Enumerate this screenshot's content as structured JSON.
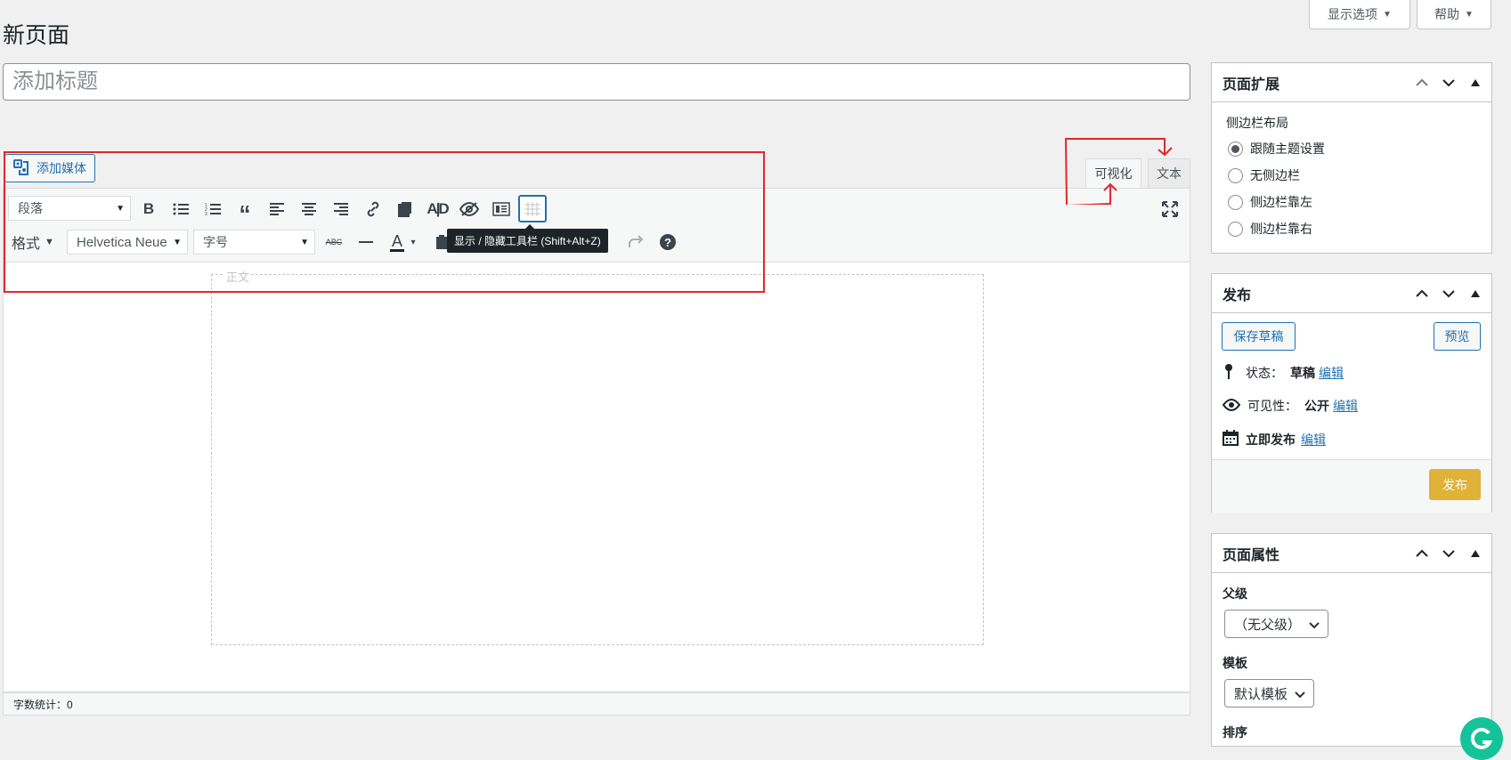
{
  "top_buttons": {
    "screen_options": "显示选项",
    "help": "帮助"
  },
  "page_title": "新页面",
  "title_input": {
    "value": "",
    "placeholder": "添加标题"
  },
  "media_button": {
    "label": "添加媒体"
  },
  "editor_tabs": {
    "visual": "可视化",
    "text": "文本"
  },
  "toolbar": {
    "format_block": "段落",
    "formats_menu": "格式",
    "font_family": "Helvetica Neue",
    "font_size": "字号",
    "tooltip": "显示 / 隐藏工具栏 (Shift+Alt+Z)",
    "strikethrough_glyph": "ABC",
    "bold_glyph": "B",
    "text_color_glyph": "A",
    "help_glyph": "?",
    "caret": "▾"
  },
  "editor": {
    "content_label": "正文"
  },
  "status_bar": {
    "word_count": "字数统计：0"
  },
  "colors": {
    "accent": "#2271b1",
    "annotation": "#e3262b",
    "publish": "#dba617"
  },
  "panels": {
    "page_extension": {
      "title": "页面扩展",
      "sidebar_layout_label": "侧边栏布局",
      "options": [
        "跟随主题设置",
        "无侧边栏",
        "侧边栏靠左",
        "侧边栏靠右"
      ],
      "selected_index": 0
    },
    "publish": {
      "title": "发布",
      "save_draft": "保存草稿",
      "preview": "预览",
      "status_label": "状态：",
      "status_value": "草稿",
      "visibility_label": "可见性：",
      "visibility_value": "公开",
      "schedule_label": "立即发布",
      "edit_link": "编辑",
      "publish_button": "发布"
    },
    "page_attributes": {
      "title": "页面属性",
      "parent_label": "父级",
      "parent_value": "（无父级）",
      "template_label": "模板",
      "template_value": "默认模板",
      "order_label": "排序"
    }
  }
}
